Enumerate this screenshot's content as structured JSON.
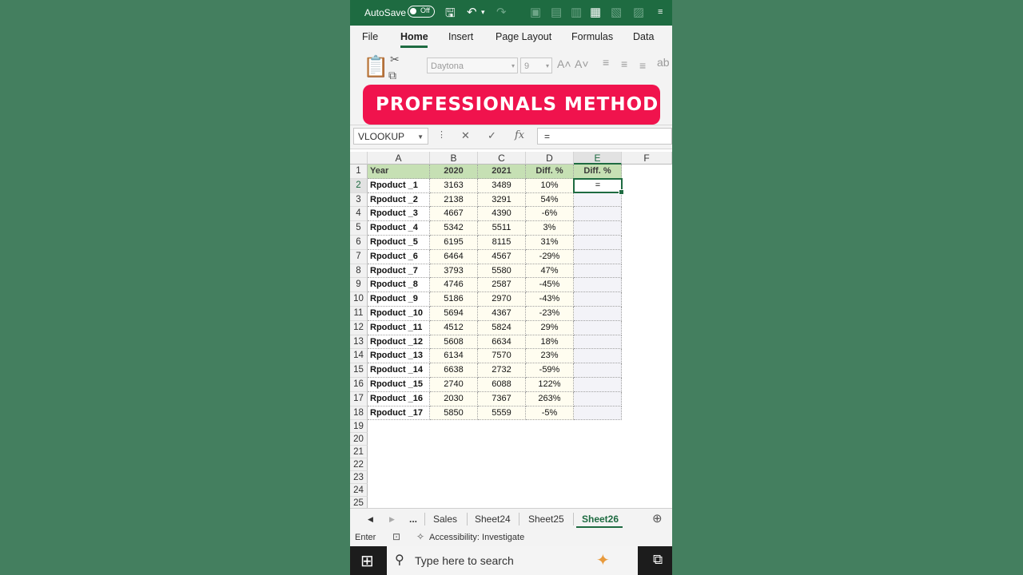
{
  "titlebar": {
    "autosave_label": "AutoSave",
    "autosave_state": "Off"
  },
  "ribbon_tabs": [
    "File",
    "Home",
    "Insert",
    "Page Layout",
    "Formulas",
    "Data"
  ],
  "ribbon": {
    "font_name": "Daytona",
    "font_size": "9"
  },
  "banner": {
    "text": "PROFESSIONALS METHOD"
  },
  "formula_bar": {
    "name_box": "VLOOKUP",
    "formula": "="
  },
  "columns": [
    "A",
    "B",
    "C",
    "D",
    "E",
    "F"
  ],
  "row_numbers": [
    "1",
    "2",
    "3",
    "4",
    "5",
    "6",
    "7",
    "8",
    "9",
    "10",
    "11",
    "12",
    "13",
    "14",
    "15",
    "16",
    "17",
    "18",
    "19",
    "20",
    "21",
    "22",
    "23",
    "24",
    "25"
  ],
  "table": {
    "headers": [
      "Year",
      "2020",
      "2021",
      "Diff. %",
      "Diff. %"
    ],
    "rows": [
      [
        "Rpoduct _1",
        "3163",
        "3489",
        "10%"
      ],
      [
        "Rpoduct _2",
        "2138",
        "3291",
        "54%"
      ],
      [
        "Rpoduct _3",
        "4667",
        "4390",
        "-6%"
      ],
      [
        "Rpoduct _4",
        "5342",
        "5511",
        "3%"
      ],
      [
        "Rpoduct _5",
        "6195",
        "8115",
        "31%"
      ],
      [
        "Rpoduct _6",
        "6464",
        "4567",
        "-29%"
      ],
      [
        "Rpoduct _7",
        "3793",
        "5580",
        "47%"
      ],
      [
        "Rpoduct _8",
        "4746",
        "2587",
        "-45%"
      ],
      [
        "Rpoduct _9",
        "5186",
        "2970",
        "-43%"
      ],
      [
        "Rpoduct _10",
        "5694",
        "4367",
        "-23%"
      ],
      [
        "Rpoduct _11",
        "4512",
        "5824",
        "29%"
      ],
      [
        "Rpoduct _12",
        "5608",
        "6634",
        "18%"
      ],
      [
        "Rpoduct _13",
        "6134",
        "7570",
        "23%"
      ],
      [
        "Rpoduct _14",
        "6638",
        "2732",
        "-59%"
      ],
      [
        "Rpoduct _15",
        "2740",
        "6088",
        "122%"
      ],
      [
        "Rpoduct _16",
        "2030",
        "7367",
        "263%"
      ],
      [
        "Rpoduct _17",
        "5850",
        "5559",
        "-5%"
      ]
    ],
    "active_cell_value": "="
  },
  "sheet_tabs": {
    "more": "...",
    "tabs": [
      "Sales",
      "Sheet24",
      "Sheet25",
      "Sheet26"
    ],
    "active": "Sheet26"
  },
  "status_bar": {
    "mode": "Enter",
    "accessibility": "Accessibility: Investigate"
  },
  "taskbar": {
    "search_placeholder": "Type here to search"
  },
  "colors": {
    "excel_green": "#1e6b41",
    "banner_red": "#f0134d",
    "header_fill": "#c6e0b4",
    "background": "#447f5f"
  }
}
